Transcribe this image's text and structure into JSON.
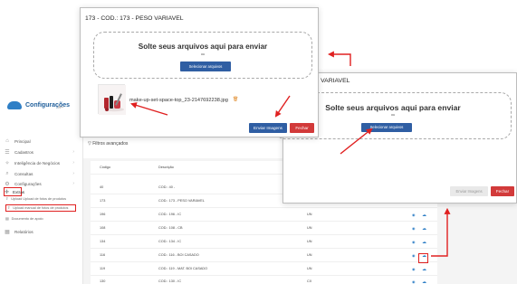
{
  "sidebar": {
    "logo_title": "Configurações",
    "logo_sub": "",
    "items": [
      {
        "label": "Principal",
        "icon": "home-icon"
      },
      {
        "label": "Cadastros",
        "icon": "list-icon"
      },
      {
        "label": "Inteligência de Negócios",
        "icon": "lightbulb-icon"
      },
      {
        "label": "Consultas",
        "icon": "search-icon"
      },
      {
        "label": "Configurações",
        "icon": "gear-icon"
      },
      {
        "label": "Extras",
        "icon": "puzzle-icon"
      },
      {
        "label": "Relatórios",
        "icon": "report-icon"
      }
    ],
    "subitems": [
      {
        "label": "Upload Upload de fotos de produtos"
      },
      {
        "label": "Upload manual de fotos de produtos"
      },
      {
        "label": "Documento de apoio"
      }
    ]
  },
  "topbar": {
    "line1": "Cliente",
    "line2": "Usuário"
  },
  "filters_label": "Filtros avançados",
  "table": {
    "headers": [
      "Código",
      "Descrição",
      "Unidade"
    ],
    "rows": [
      {
        "code": "40",
        "desc": "COD.: 40 -",
        "unit": ""
      },
      {
        "code": "173",
        "desc": "COD.: 173 - PESO VARIAVEL",
        "unit": "UN"
      },
      {
        "code": "196",
        "desc": "COD.: 196 - IC",
        "unit": "UN"
      },
      {
        "code": "108",
        "desc": "COD.: 108 - CB",
        "unit": "UN"
      },
      {
        "code": "134",
        "desc": "COD.: 134 - IC",
        "unit": "UN"
      },
      {
        "code": "116",
        "desc": "COD.: 116 - BOI CASADO",
        "unit": "UN"
      },
      {
        "code": "119",
        "desc": "COD.: 119 - MAT. BOI CASADO",
        "unit": "UN"
      },
      {
        "code": "130",
        "desc": "COD.: 130 - IC",
        "unit": "CX"
      }
    ]
  },
  "modal_main": {
    "title": "173 - COD.: 173 - PESO VARIAVEL",
    "drop_title": "Solte seus arquivos aqui para enviar",
    "drop_or": "ou",
    "select_button": "Selecionar arquivos",
    "file_name": "make-up-set-space-top_23-2147692238.jpg",
    "send_button": "Enviar Imagens",
    "close_button": "Fechar"
  },
  "modal_second": {
    "title": "173 - PESO VARIAVEL",
    "drop_title": "Solte seus arquivos aqui para enviar",
    "drop_or": "ou",
    "select_button": "Selecionar arquivos",
    "send_button": "Enviar Imagens",
    "close_button": "Fechar"
  },
  "colors": {
    "annotation": "#e02020",
    "primary": "#2f5ea3",
    "danger": "#d23a3a"
  }
}
